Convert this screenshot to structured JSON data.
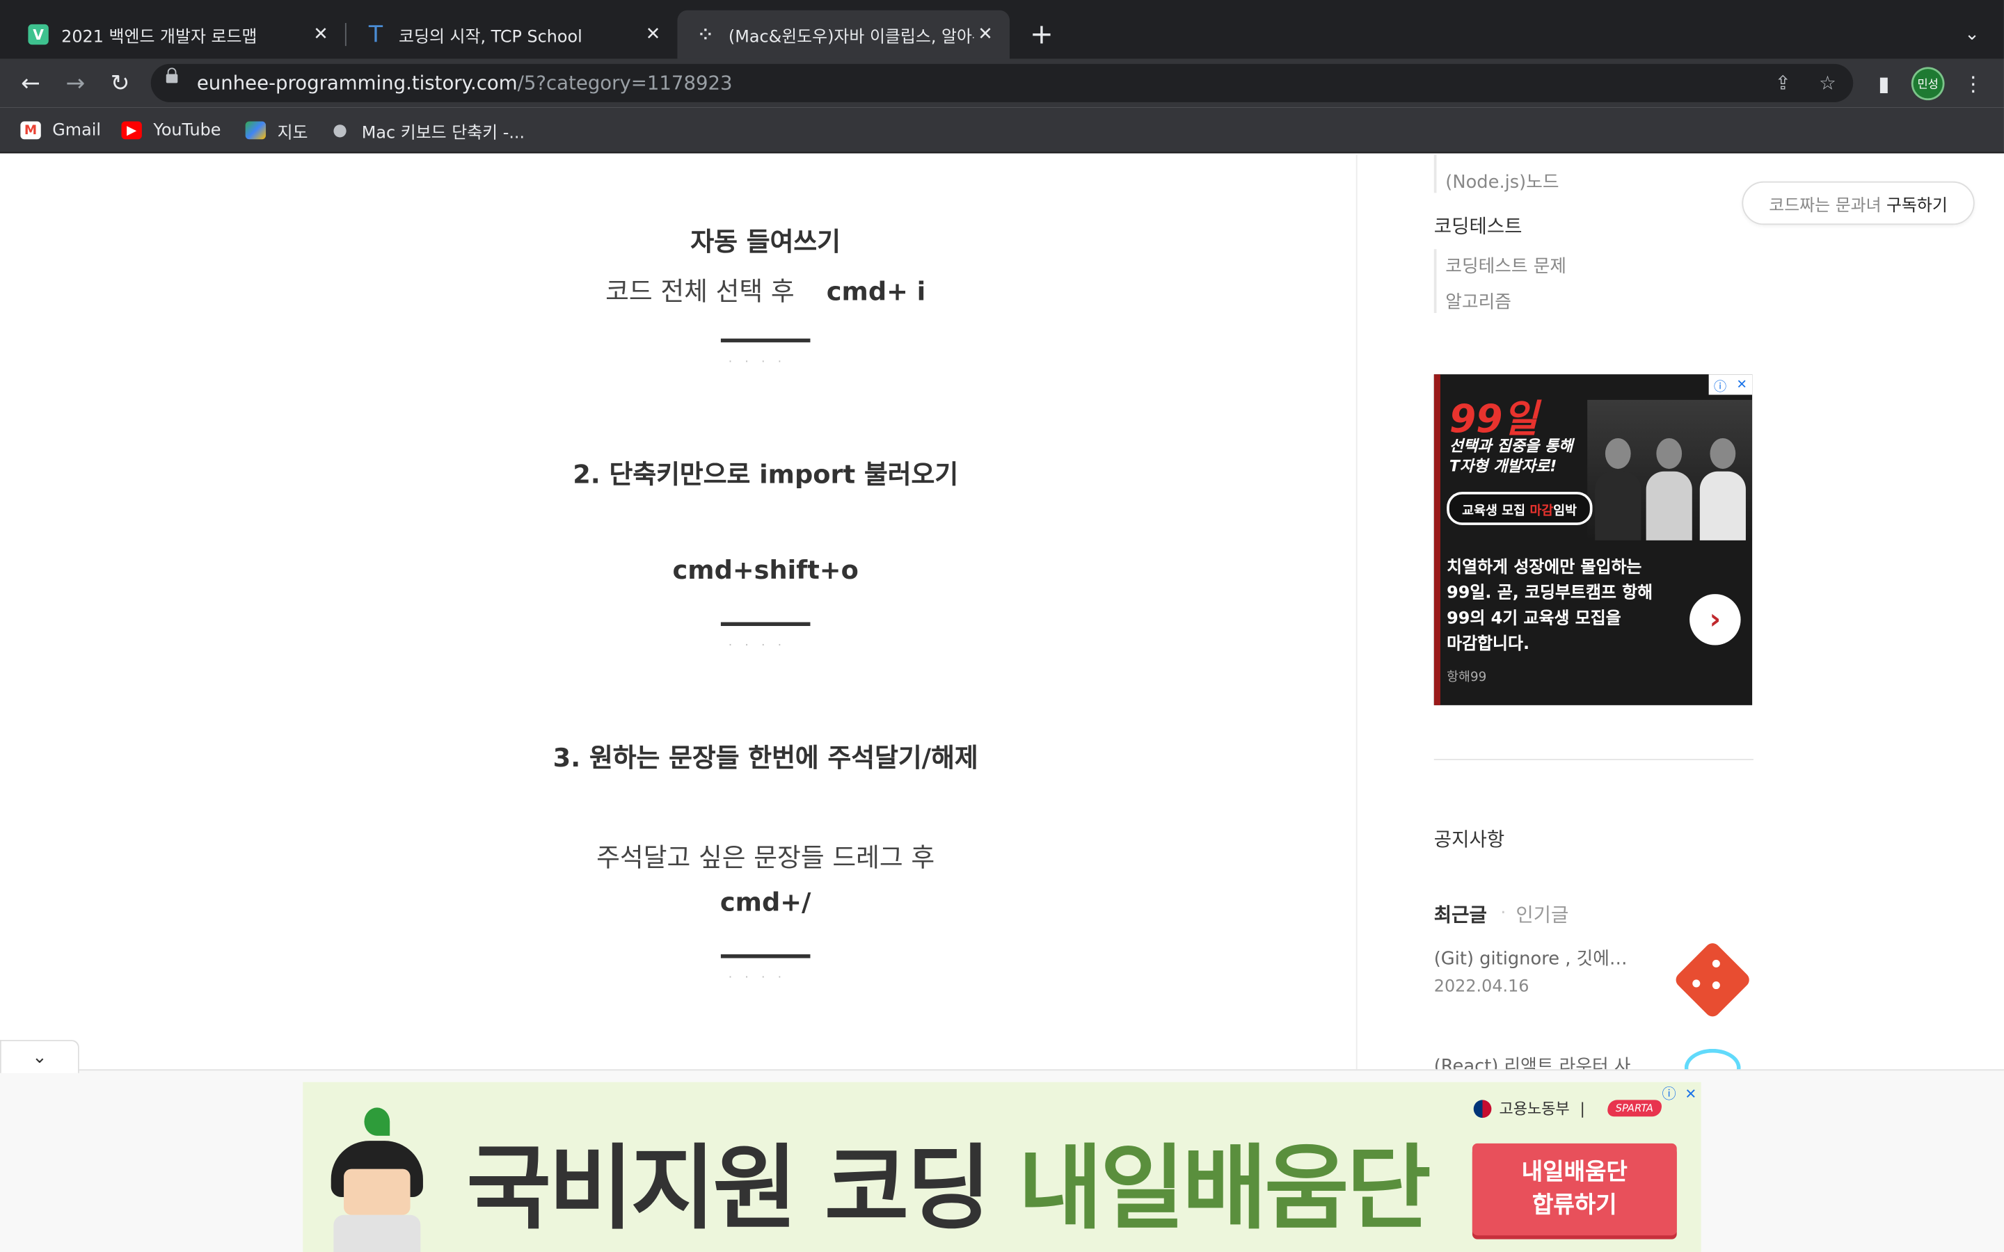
{
  "browser": {
    "tabs": [
      {
        "title": "2021 백엔드 개발자 로드맵",
        "icon": "v-favicon-icon",
        "active": false
      },
      {
        "title": "코딩의 시작, TCP School",
        "icon": "t-favicon-icon",
        "active": false
      },
      {
        "title": "(Mac&윈도우)자바 이클립스, 알아두",
        "icon": "tistory-favicon-icon",
        "active": true
      }
    ],
    "new_tab_symbol": "+",
    "tab_close_symbol": "✕",
    "url_host": "eunhee-programming.tistory.com",
    "url_path": "/5?category=1178923",
    "profile_label": "민성",
    "bookmarks": [
      {
        "label": "Gmail",
        "icon": "gmail-icon"
      },
      {
        "label": "YouTube",
        "icon": "youtube-icon"
      },
      {
        "label": "지도",
        "icon": "maps-icon"
      },
      {
        "label": "Mac 키보드 단축키 -...",
        "icon": "apple-icon"
      }
    ]
  },
  "article": {
    "section1_heading": "자동 들여쓰기",
    "section1_text": "코드 전체 선택 후",
    "section1_code": "cmd+ i",
    "section2_heading": "2. 단축키만으로 import 불러오기",
    "section2_code": "cmd+shift+o",
    "section3_heading": "3. 원하는 문장들 한번에 주석달기/해제",
    "section3_text": "주석달고 싶은 문장들 드레그 후",
    "section3_code": "cmd+/",
    "dots": "····"
  },
  "sidebar": {
    "cat_node": "(Node.js)노드",
    "cat_codingtest": "코딩테스트",
    "cat_codingtest_problems": "코딩테스트 문제",
    "cat_algorithm": "알고리즘",
    "subscribe_prefix": "코드짜는 문과녀",
    "subscribe_action": "구독하기",
    "notice_title": "공지사항",
    "tab_recent": "최근글",
    "tab_popular": "인기글",
    "post1_title": "(Git) gitignore , 깃에…",
    "post1_date": "2022.04.16",
    "post2_title": "(React) 리액트 라우터 사…"
  },
  "side_ad": {
    "headline": "99일",
    "tagline_line1": "선택과 집중을 통해",
    "tagline_line2": "T자형 개발자로!",
    "pill_prefix": "교육생 모집 ",
    "pill_red": "마감",
    "pill_suffix": "임박",
    "copy_line1": "치열하게 성장에만 몰입하는",
    "copy_line2": "99일. 곧, 코딩부트캠프 항해",
    "copy_line3": "99의 4기 교육생 모집을",
    "copy_line4": "마감합니다.",
    "source": "항해99",
    "info_symbol": "ⓘ",
    "close_symbol": "✕"
  },
  "bottom_ad": {
    "headline_dark": "국비지원 코딩 ",
    "headline_green": "내일배움단",
    "ministry": "고용노동부",
    "brand": "SPARTA",
    "cta_line1": "내일배움단",
    "cta_line2": "합류하기",
    "info_symbol": "ⓘ",
    "close_symbol": "✕"
  },
  "colors": {
    "chrome_dark": "#202124",
    "chrome_toolbar": "#35363a",
    "ad_red": "#e8332e",
    "banner_green": "#5a8f3d",
    "cta_red": "#e8505b"
  }
}
